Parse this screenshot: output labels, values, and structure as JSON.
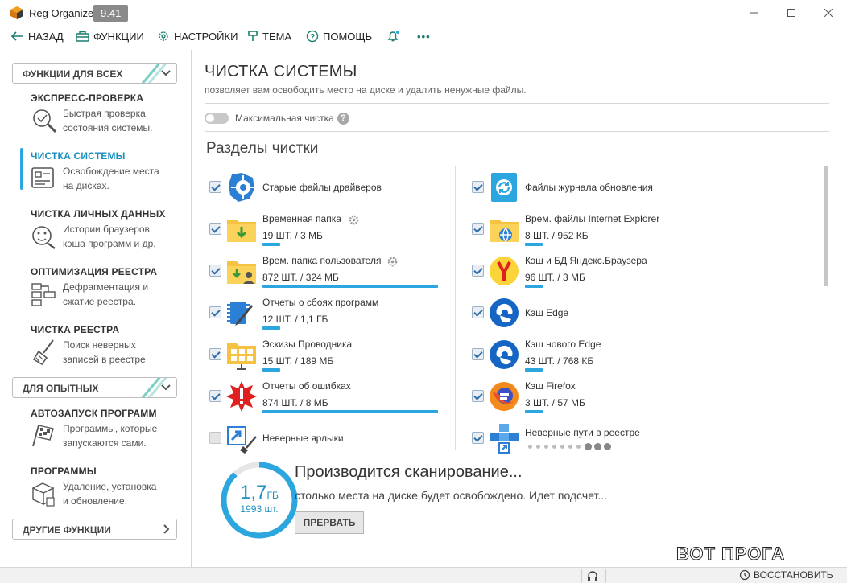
{
  "app": {
    "name": "Reg Organizer",
    "version": "9.41"
  },
  "toolbar": {
    "back": "НАЗАД",
    "functions": "ФУНКЦИИ",
    "settings": "НАСТРОЙКИ",
    "theme": "ТЕМА",
    "help": "ПОМОЩЬ",
    "more": "•••"
  },
  "sidebar": {
    "group_all": "ФУНКЦИИ ДЛЯ ВСЕХ",
    "group_adv": "ДЛЯ ОПЫТНЫХ",
    "group_other": "ДРУГИЕ ФУНКЦИИ",
    "items": [
      {
        "title": "ЭКСПРЕСС-ПРОВЕРКА",
        "desc1": "Быстрая проверка",
        "desc2": "состояния системы."
      },
      {
        "title": "ЧИСТКА СИСТЕМЫ",
        "desc1": "Освобождение места",
        "desc2": "на дисках."
      },
      {
        "title": "ЧИСТКА ЛИЧНЫХ ДАННЫХ",
        "desc1": "Истории браузеров,",
        "desc2": "кэша программ и др."
      },
      {
        "title": "ОПТИМИЗАЦИЯ РЕЕСТРА",
        "desc1": "Дефрагментация и",
        "desc2": "сжатие реестра."
      },
      {
        "title": "ЧИСТКА РЕЕСТРА",
        "desc1": "Поиск неверных",
        "desc2": "записей в реестре"
      },
      {
        "title": "АВТОЗАПУСК ПРОГРАММ",
        "desc1": "Программы, которые",
        "desc2": "запускаются сами."
      },
      {
        "title": "ПРОГРАММЫ",
        "desc1": "Удаление, установка",
        "desc2": "и обновление."
      }
    ]
  },
  "main": {
    "title": "ЧИСТКА СИСТЕМЫ",
    "subtitle": "позволяет вам освободить место на диске и удалить ненужные файлы.",
    "max_clean": "Максимальная чистка",
    "help_mark": "?",
    "sections_title": "Разделы чистки",
    "left": [
      {
        "title": "Старые файлы драйверов",
        "stats": "",
        "checked": true,
        "progress": 0
      },
      {
        "title": "Временная папка",
        "stats": "19 ШТ. / 3 МБ",
        "checked": true,
        "progress": 0.1
      },
      {
        "title": "Врем. папка пользователя",
        "stats": "872 ШТ. / 324 МБ",
        "checked": true,
        "progress": 1.0
      },
      {
        "title": "Отчеты о сбоях программ",
        "stats": "12 ШТ. / 1,1 ГБ",
        "checked": true,
        "progress": 0.1
      },
      {
        "title": "Эскизы Проводника",
        "stats": "15 ШТ. / 189 МБ",
        "checked": true,
        "progress": 0.1
      },
      {
        "title": "Отчеты об ошибках",
        "stats": "874 ШТ. / 8 МБ",
        "checked": true,
        "progress": 1.0
      },
      {
        "title": "Неверные ярлыки",
        "stats": "",
        "checked": false,
        "progress": 0
      }
    ],
    "right": [
      {
        "title": "Файлы журнала обновления",
        "stats": "",
        "checked": true,
        "progress": 0
      },
      {
        "title": "Врем. файлы Internet Explorer",
        "stats": "8 ШТ. / 952 КБ",
        "checked": true,
        "progress": 0.1
      },
      {
        "title": "Кэш и БД Яндекс.Браузера",
        "stats": "96 ШТ. / 3 МБ",
        "checked": true,
        "progress": 0.1
      },
      {
        "title": "Кэш Edge",
        "stats": "",
        "checked": true,
        "progress": 0
      },
      {
        "title": "Кэш нового Edge",
        "stats": "43 ШТ. / 768 КБ",
        "checked": true,
        "progress": 0.1
      },
      {
        "title": "Кэш Firefox",
        "stats": "3 ШТ. / 57 МБ",
        "checked": true,
        "progress": 0.1
      },
      {
        "title": "Неверные пути в реестре",
        "stats": "",
        "checked": true,
        "progress": 0
      }
    ]
  },
  "scan": {
    "value": "1,7",
    "unit": "ГБ",
    "count": "1993 шт.",
    "title": "Производится сканирование...",
    "subtitle": "столько места на диске будет освобождено. Идет подсчет...",
    "stop": "ПРЕРВАТЬ",
    "progress": 0.88
  },
  "watermark": "ВОТ ПРОГА",
  "status": {
    "restore": "ВОССТАНОВИТЬ"
  },
  "colors": {
    "accent": "#2ba6de",
    "accent_dark": "#1c8fc0",
    "stripe": "#7ccfc4"
  }
}
